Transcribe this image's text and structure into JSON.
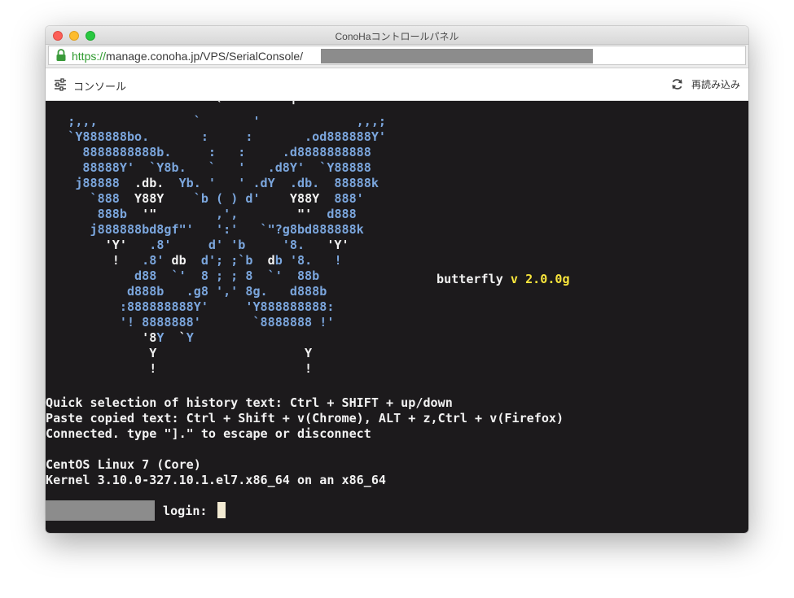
{
  "window": {
    "title": "ConoHaコントロールパネル"
  },
  "address": {
    "scheme": "https://",
    "host": "manage.conoha.jp",
    "path": "/VPS/SerialConsole/"
  },
  "toolbar": {
    "console_label": "コンソール",
    "reload_label": "再読み込み"
  },
  "terminal": {
    "art_lines": [
      {
        "text": "                       `         '",
        "cls": "white"
      },
      {
        "text": "   ;,,,             `       '             ,,,;",
        "cls": "blue"
      },
      {
        "text": "   `Y888888bo.       :     :       .od888888Y'",
        "cls": "blue"
      },
      {
        "text": "     8888888888b.     :   :     .d8888888888",
        "cls": "blue"
      },
      {
        "text": "     88888Y'  `Y8b.   `   '   .d8Y'  `Y88888",
        "cls": "blue"
      },
      {
        "text": "    j88888  .db.  Yb. '   ' .dY  .db.  88888k",
        "cls": "mixed1"
      },
      {
        "text": "      `888  Y88Y    `b ( ) d'    Y88Y  888'",
        "cls": "mixed2"
      },
      {
        "text": "       888b  '\"        ,',        \"'  d888",
        "cls": "mixed3"
      },
      {
        "text": "      j888888bd8gf\"'   ':'   `\"?g8bd888888k",
        "cls": "blue"
      },
      {
        "text": "        'Y'   .8'     d' 'b     '8.   'Y'",
        "cls": "mixed4"
      },
      {
        "text": "         !   .8' db  d'; ;`b  db '8.   !",
        "cls": "mixed5"
      },
      {
        "text": "            d88  `'  8 ; ; 8  `'  88b",
        "cls": "blue"
      },
      {
        "text": "           d888b   .g8 ',' 8g.   d888b",
        "cls": "blue"
      },
      {
        "text": "          :888888888Y'     'Y888888888:",
        "cls": "blue"
      },
      {
        "text": "          '! 8888888'       `8888888 !'",
        "cls": "blue"
      },
      {
        "text": "             '8Y  `Y",
        "cls": "mixed6"
      },
      {
        "text": "              Y                    Y",
        "cls": "white"
      },
      {
        "text": "              !                    !",
        "cls": "white"
      }
    ],
    "version_label": "butterfly",
    "version_value": "v 2.0.0g",
    "lines": [
      "Quick selection of history text: Ctrl + SHIFT + up/down",
      "Paste copied text: Ctrl + Shift + v(Chrome), ALT + z,Ctrl + v(Firefox)",
      "Connected. type \"].\" to escape or disconnect",
      "",
      "CentOS Linux 7 (Core)",
      "Kernel 3.10.0-327.10.1.el7.x86_64 on an x86_64"
    ],
    "login_prompt": "login: "
  },
  "colors": {
    "terminal_bg": "#1c1a1c",
    "art_blue": "#7ba6dd",
    "version_yellow": "#f7e43c",
    "url_green": "#2e9a2e"
  },
  "icons": {
    "lock": "lock-icon",
    "menu": "sliders-icon",
    "reload": "reload-icon"
  }
}
